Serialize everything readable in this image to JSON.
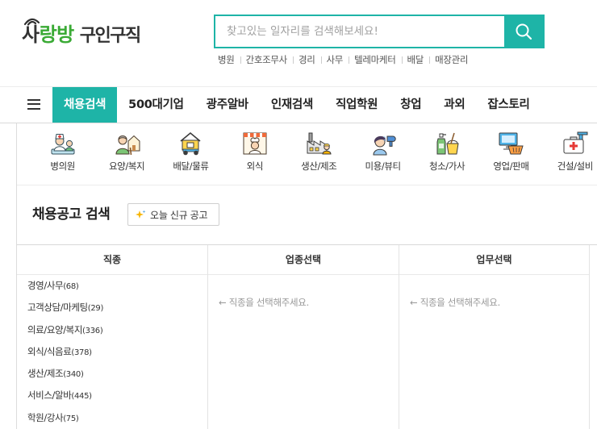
{
  "header": {
    "logo": {
      "brand_a": "사",
      "brand_b": "랑방",
      "service": "구인구직",
      "icon": "signal-icon"
    },
    "search": {
      "placeholder": "찾고있는 일자리를 검색해보세요!",
      "value": "",
      "button_icon": "search-icon"
    },
    "keywords": [
      "병원",
      "간호조무사",
      "경리",
      "사무",
      "텔레마케터",
      "배달",
      "매장관리"
    ]
  },
  "nav": {
    "menu_icon": "hamburger-menu-icon",
    "items": [
      {
        "label": "채용검색",
        "active": true
      },
      {
        "label": "500대기업",
        "active": false
      },
      {
        "label": "광주알바",
        "active": false
      },
      {
        "label": "인재검색",
        "active": false
      },
      {
        "label": "직업학원",
        "active": false
      },
      {
        "label": "창업",
        "active": false
      },
      {
        "label": "과외",
        "active": false
      },
      {
        "label": "잡스토리",
        "active": false
      }
    ]
  },
  "categories": [
    {
      "label": "병의원",
      "icon": "hospital-icon"
    },
    {
      "label": "요양/복지",
      "icon": "caregiver-icon"
    },
    {
      "label": "배달/물류",
      "icon": "delivery-icon"
    },
    {
      "label": "외식",
      "icon": "restaurant-icon"
    },
    {
      "label": "생산/제조",
      "icon": "factory-icon"
    },
    {
      "label": "미용/뷰티",
      "icon": "beauty-icon"
    },
    {
      "label": "청소/가사",
      "icon": "cleaning-icon"
    },
    {
      "label": "영업/판매",
      "icon": "sales-icon"
    },
    {
      "label": "건설/설비",
      "icon": "construction-icon"
    }
  ],
  "search_section": {
    "title": "채용공고 검색",
    "today_button": {
      "label": "오늘 신규 공고",
      "icon": "sparkle-icon"
    }
  },
  "finder": {
    "columns": [
      "직종",
      "업종선택",
      "업무선택"
    ],
    "job_types": [
      {
        "name": "경영/사무",
        "count": "(68)"
      },
      {
        "name": "고객상담/마케팅",
        "count": "(29)"
      },
      {
        "name": "의료/요양/복지",
        "count": "(336)"
      },
      {
        "name": "외식/식음료",
        "count": "(378)"
      },
      {
        "name": "생산/제조",
        "count": "(340)"
      },
      {
        "name": "서비스/알바",
        "count": "(445)"
      },
      {
        "name": "학원/강사",
        "count": "(75)"
      }
    ],
    "industry_hint": "← 직종을 선택해주세요.",
    "task_hint": "← 직종을 선택해주세요."
  },
  "colors": {
    "accent": "#1eb4a7",
    "logo_green": "#3aaa35",
    "text": "#222222",
    "muted": "#999999",
    "border": "#dddddd"
  }
}
